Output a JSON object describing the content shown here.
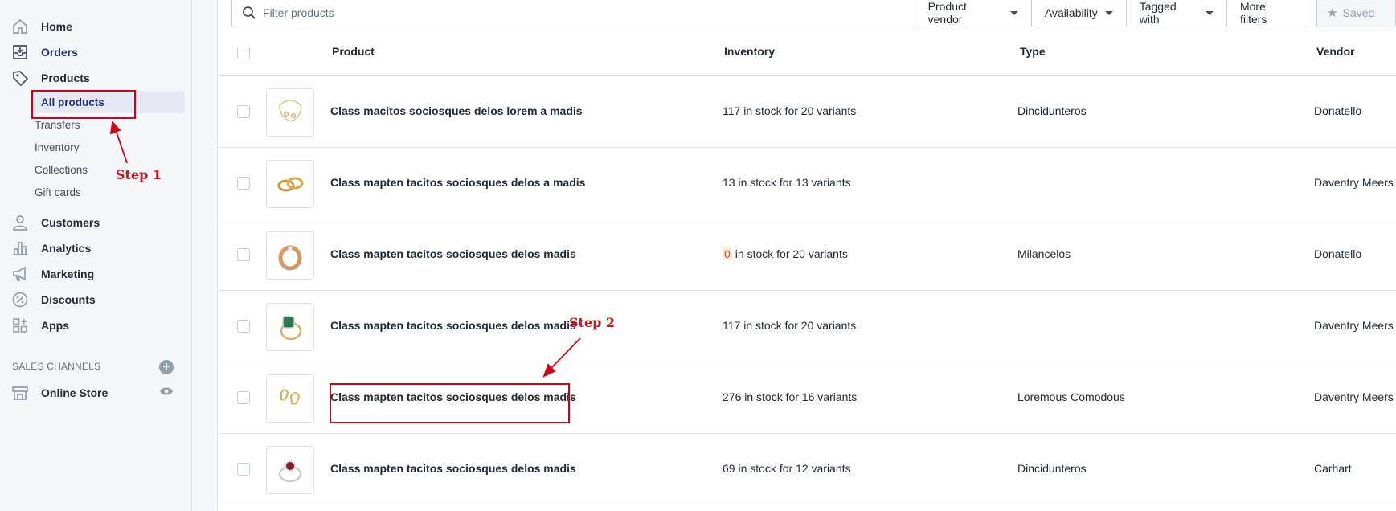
{
  "sidebar": {
    "items": [
      {
        "label": "Home",
        "icon": "home-icon"
      },
      {
        "label": "Orders",
        "icon": "orders-icon"
      },
      {
        "label": "Products",
        "icon": "tag-icon"
      },
      {
        "label": "Customers",
        "icon": "person-icon"
      },
      {
        "label": "Analytics",
        "icon": "analytics-icon"
      },
      {
        "label": "Marketing",
        "icon": "megaphone-icon"
      },
      {
        "label": "Discounts",
        "icon": "discount-icon"
      },
      {
        "label": "Apps",
        "icon": "apps-icon"
      }
    ],
    "product_subitems": [
      "All products",
      "Transfers",
      "Inventory",
      "Collections",
      "Gift cards"
    ],
    "sales_channels_title": "SALES CHANNELS",
    "online_store": "Online Store"
  },
  "search": {
    "placeholder": "Filter products"
  },
  "filters": [
    "Product vendor",
    "Availability",
    "Tagged with"
  ],
  "more_filters": "More filters",
  "saved": "Saved",
  "table": {
    "headers": {
      "product": "Product",
      "inventory": "Inventory",
      "type": "Type",
      "vendor": "Vendor"
    },
    "rows": [
      {
        "name": "Class macitos sociosques delos lorem a madis",
        "inventory": "117 in stock for 20 variants",
        "type": "Dincidunteros",
        "vendor": "Donatello"
      },
      {
        "name": "Class mapten tacitos sociosques delos a madis",
        "inventory": "13 in stock for 13 variants",
        "type": "",
        "vendor": "Daventry Meers"
      },
      {
        "name": "Class mapten tacitos sociosques delos madis",
        "inventory_zero": "0",
        "inventory": "in stock for 20 variants",
        "type": "Milancelos",
        "vendor": "Donatello"
      },
      {
        "name": "Class mapten tacitos sociosques delos madis",
        "inventory": "117 in stock for 20 variants",
        "type": "",
        "vendor": "Daventry Meers"
      },
      {
        "name": "Class mapten tacitos sociosques delos madis",
        "inventory": "276 in stock for 16 variants",
        "type": "Loremous Comodous",
        "vendor": "Daventry Meers"
      },
      {
        "name": "Class mapten tacitos sociosques delos madis",
        "inventory": "69 in stock for 12 variants",
        "type": "Dincidunteros",
        "vendor": "Carhart"
      }
    ]
  },
  "annotations": {
    "step1": "Step 1",
    "step2": "Step 2",
    "color": "#d0021b"
  }
}
